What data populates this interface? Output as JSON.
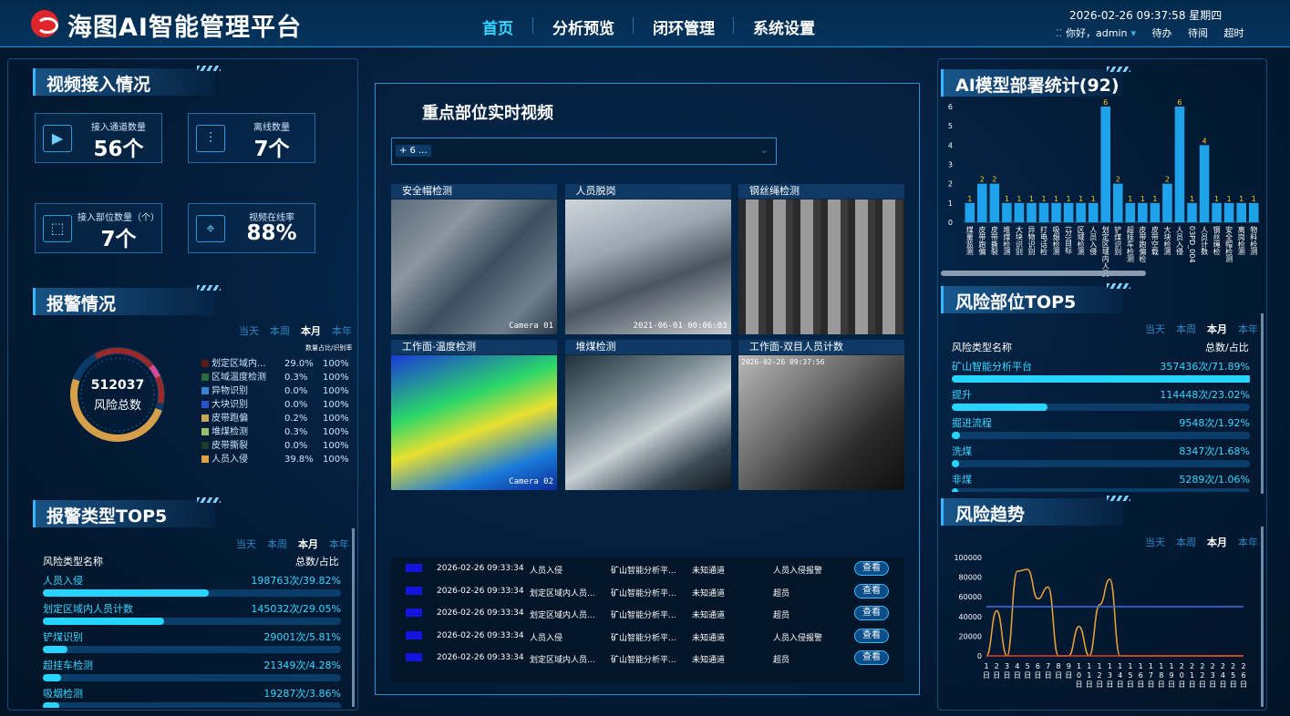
{
  "header": {
    "app_title": "海图AI智能管理平台",
    "nav": [
      "首页",
      "分析预览",
      "闭环管理",
      "系统设置"
    ],
    "datetime": "2026-02-26 09:37:58 星期四",
    "greeting": "你好，admin",
    "user_links": [
      "待办",
      "待阅",
      "超时"
    ]
  },
  "video_access": {
    "title": "视频接入情况",
    "stats": [
      {
        "label": "接入通道数量",
        "value": "56个",
        "icon": "play-icon"
      },
      {
        "label": "离线数量",
        "value": "7个",
        "icon": "sliders-icon"
      },
      {
        "label": "接入部位数量（个）",
        "value": "7个",
        "icon": "frame-icon"
      },
      {
        "label": "视频在线率",
        "value": "88%",
        "icon": "target-icon"
      }
    ]
  },
  "alarm": {
    "title": "报警情况",
    "filters": [
      "当天",
      "本周",
      "本月",
      "本年"
    ],
    "active_filter": "本月",
    "ring_value": "512037",
    "ring_label": "风险总数",
    "legend_header": "数量占比/识别率",
    "legend": [
      {
        "name": "划定区域内...",
        "pct": "29.0%",
        "rate": "100%",
        "color": "#5a1a1a"
      },
      {
        "name": "区域温度检测",
        "pct": "0.3%",
        "rate": "100%",
        "color": "#2e6a3a"
      },
      {
        "name": "异物识别",
        "pct": "0.0%",
        "rate": "100%",
        "color": "#3a7fd6"
      },
      {
        "name": "大块识别",
        "pct": "0.0%",
        "rate": "100%",
        "color": "#2952c8"
      },
      {
        "name": "皮带跑偏",
        "pct": "0.2%",
        "rate": "100%",
        "color": "#c9a45a"
      },
      {
        "name": "堆煤检测",
        "pct": "0.3%",
        "rate": "100%",
        "color": "#9bc06a"
      },
      {
        "name": "皮带撕裂",
        "pct": "0.0%",
        "rate": "100%",
        "color": "#1f3a2a"
      },
      {
        "name": "人员入侵",
        "pct": "39.8%",
        "rate": "100%",
        "color": "#e0a040"
      }
    ]
  },
  "alarm_top5": {
    "title": "报警类型TOP5",
    "filters": [
      "当天",
      "本周",
      "本月",
      "本年"
    ],
    "active_filter": "本月",
    "col_name": "风险类型名称",
    "col_value": "总数/占比",
    "rows": [
      {
        "name": "人员入侵",
        "value": "198763次/39.82%",
        "fraction": 0.3982
      },
      {
        "name": "划定区域内人员计数",
        "value": "145032次/29.05%",
        "fraction": 0.2905
      },
      {
        "name": "铲煤识别",
        "value": "29001次/5.81%",
        "fraction": 0.0581
      },
      {
        "name": "超挂车检测",
        "value": "21349次/4.28%",
        "fraction": 0.0428
      },
      {
        "name": "吸烟检测",
        "value": "19287次/3.86%",
        "fraction": 0.0386
      }
    ]
  },
  "center": {
    "title": "重点部位实时视频",
    "select_value": "+ 6 ...",
    "cameras": [
      {
        "title": "安全帽检测",
        "overlay": "Camera 01"
      },
      {
        "title": "人员脱岗",
        "overlay": "2021-06-01 00:06:03"
      },
      {
        "title": "钢丝绳检测",
        "overlay": ""
      },
      {
        "title": "工作面-温度检测",
        "overlay": "Camera 02"
      },
      {
        "title": "堆煤检测",
        "overlay": ""
      },
      {
        "title": "工作面-双目人员计数",
        "overlay": "2026-02-26 09:37:56"
      }
    ],
    "alarms": [
      {
        "time": "2026-02-26 09:33:34",
        "type": "人员入侵",
        "platform": "矿山智能分析平...",
        "channel": "未知通道",
        "desc": "人员入侵报警",
        "action": "查看"
      },
      {
        "time": "2026-02-26 09:33:34",
        "type": "划定区域内人员...",
        "platform": "矿山智能分析平...",
        "channel": "未知通道",
        "desc": "超员",
        "action": "查看"
      },
      {
        "time": "2026-02-26 09:33:34",
        "type": "划定区域内人员...",
        "platform": "矿山智能分析平...",
        "channel": "未知通道",
        "desc": "超员",
        "action": "查看"
      },
      {
        "time": "2026-02-26 09:33:34",
        "type": "人员入侵",
        "platform": "矿山智能分析平...",
        "channel": "未知通道",
        "desc": "人员入侵报警",
        "action": "查看"
      },
      {
        "time": "2026-02-26 09:33:34",
        "type": "划定区域内人员...",
        "platform": "矿山智能分析平...",
        "channel": "未知通道",
        "desc": "超员",
        "action": "查看"
      }
    ]
  },
  "model_stats": {
    "title": "AI模型部署统计(92)"
  },
  "risk_top5": {
    "title": "风险部位TOP5",
    "filters": [
      "当天",
      "本周",
      "本月",
      "本年"
    ],
    "active_filter": "本月",
    "col_name": "风险类型名称",
    "col_value": "总数/占比",
    "rows": [
      {
        "name": "矿山智能分析平台",
        "value": "357436次/71.89%",
        "fraction": 0.7189
      },
      {
        "name": "提升",
        "value": "114448次/23.02%",
        "fraction": 0.2302
      },
      {
        "name": "掘进流程",
        "value": "9548次/1.92%",
        "fraction": 0.0192
      },
      {
        "name": "洗煤",
        "value": "8347次/1.68%",
        "fraction": 0.0168
      },
      {
        "name": "非煤",
        "value": "5289次/1.06%",
        "fraction": 0.0106
      }
    ]
  },
  "risk_trend": {
    "title": "风险趋势",
    "filters": [
      "当天",
      "本周",
      "本月",
      "本年"
    ],
    "active_filter": "本月"
  },
  "chart_data": [
    {
      "type": "bar",
      "title": "AI模型部署统计(92)",
      "ylim": [
        0,
        6
      ],
      "yticks": [
        0,
        1,
        2,
        3,
        4,
        5,
        6
      ],
      "color": "#1ea2ea",
      "values": [
        1,
        2,
        2,
        1,
        1,
        1,
        1,
        1,
        1,
        1,
        1,
        6,
        2,
        1,
        1,
        1,
        2,
        6,
        1,
        4,
        1,
        1,
        1,
        1
      ],
      "categories": [
        "煤量监测",
        "皮带跑偏",
        "皮带撕裂",
        "堆煤检测",
        "大块识别",
        "异物识别",
        "打电话检",
        "吸烟检测",
        "(分)目标",
        "区域检测",
        "人员入侵",
        "划定区域内人员",
        "铲煤识别",
        "超挂车检测",
        "皮带跑偏检",
        "皮带空载",
        "大块检测",
        "人员入侵",
        "03PD_004",
        "人员计数",
        "钢丝绳检",
        "安全帽检测",
        "离岗检测",
        "物料检测"
      ]
    },
    {
      "type": "line",
      "title": "风险趋势",
      "ylim": [
        0,
        100000
      ],
      "yticks": [
        0,
        20000,
        40000,
        60000,
        80000,
        100000
      ],
      "x": [
        "1日",
        "2日",
        "3日",
        "4日",
        "5日",
        "6日",
        "7日",
        "8日",
        "9日",
        "10日",
        "11日",
        "12日",
        "13日",
        "14日",
        "15日",
        "16日",
        "17日",
        "18日",
        "19日",
        "20日",
        "21日",
        "22日",
        "23日",
        "24日",
        "25日",
        "26日"
      ],
      "series": [
        {
          "color": "#e8a53a",
          "values": [
            0,
            46000,
            0,
            86000,
            88000,
            58000,
            70000,
            0,
            0,
            30000,
            0,
            52000,
            78000,
            0,
            0,
            0,
            0,
            0,
            0,
            0,
            0,
            0,
            0,
            0,
            0,
            0
          ]
        },
        {
          "color": "#e0402e",
          "values": [
            0,
            0,
            0,
            0,
            0,
            0,
            0,
            0,
            0,
            0,
            0,
            0,
            0,
            0,
            0,
            0,
            0,
            0,
            0,
            0,
            0,
            0,
            0,
            0,
            0,
            0
          ]
        },
        {
          "color": "#3a6ee8",
          "values": [
            50000,
            50000,
            50000,
            50000,
            50000,
            50000,
            50000,
            50000,
            50000,
            50000,
            50000,
            50000,
            50000,
            50000,
            50000,
            50000,
            50000,
            50000,
            50000,
            50000,
            50000,
            50000,
            50000,
            50000,
            50000,
            50000
          ]
        }
      ]
    }
  ]
}
